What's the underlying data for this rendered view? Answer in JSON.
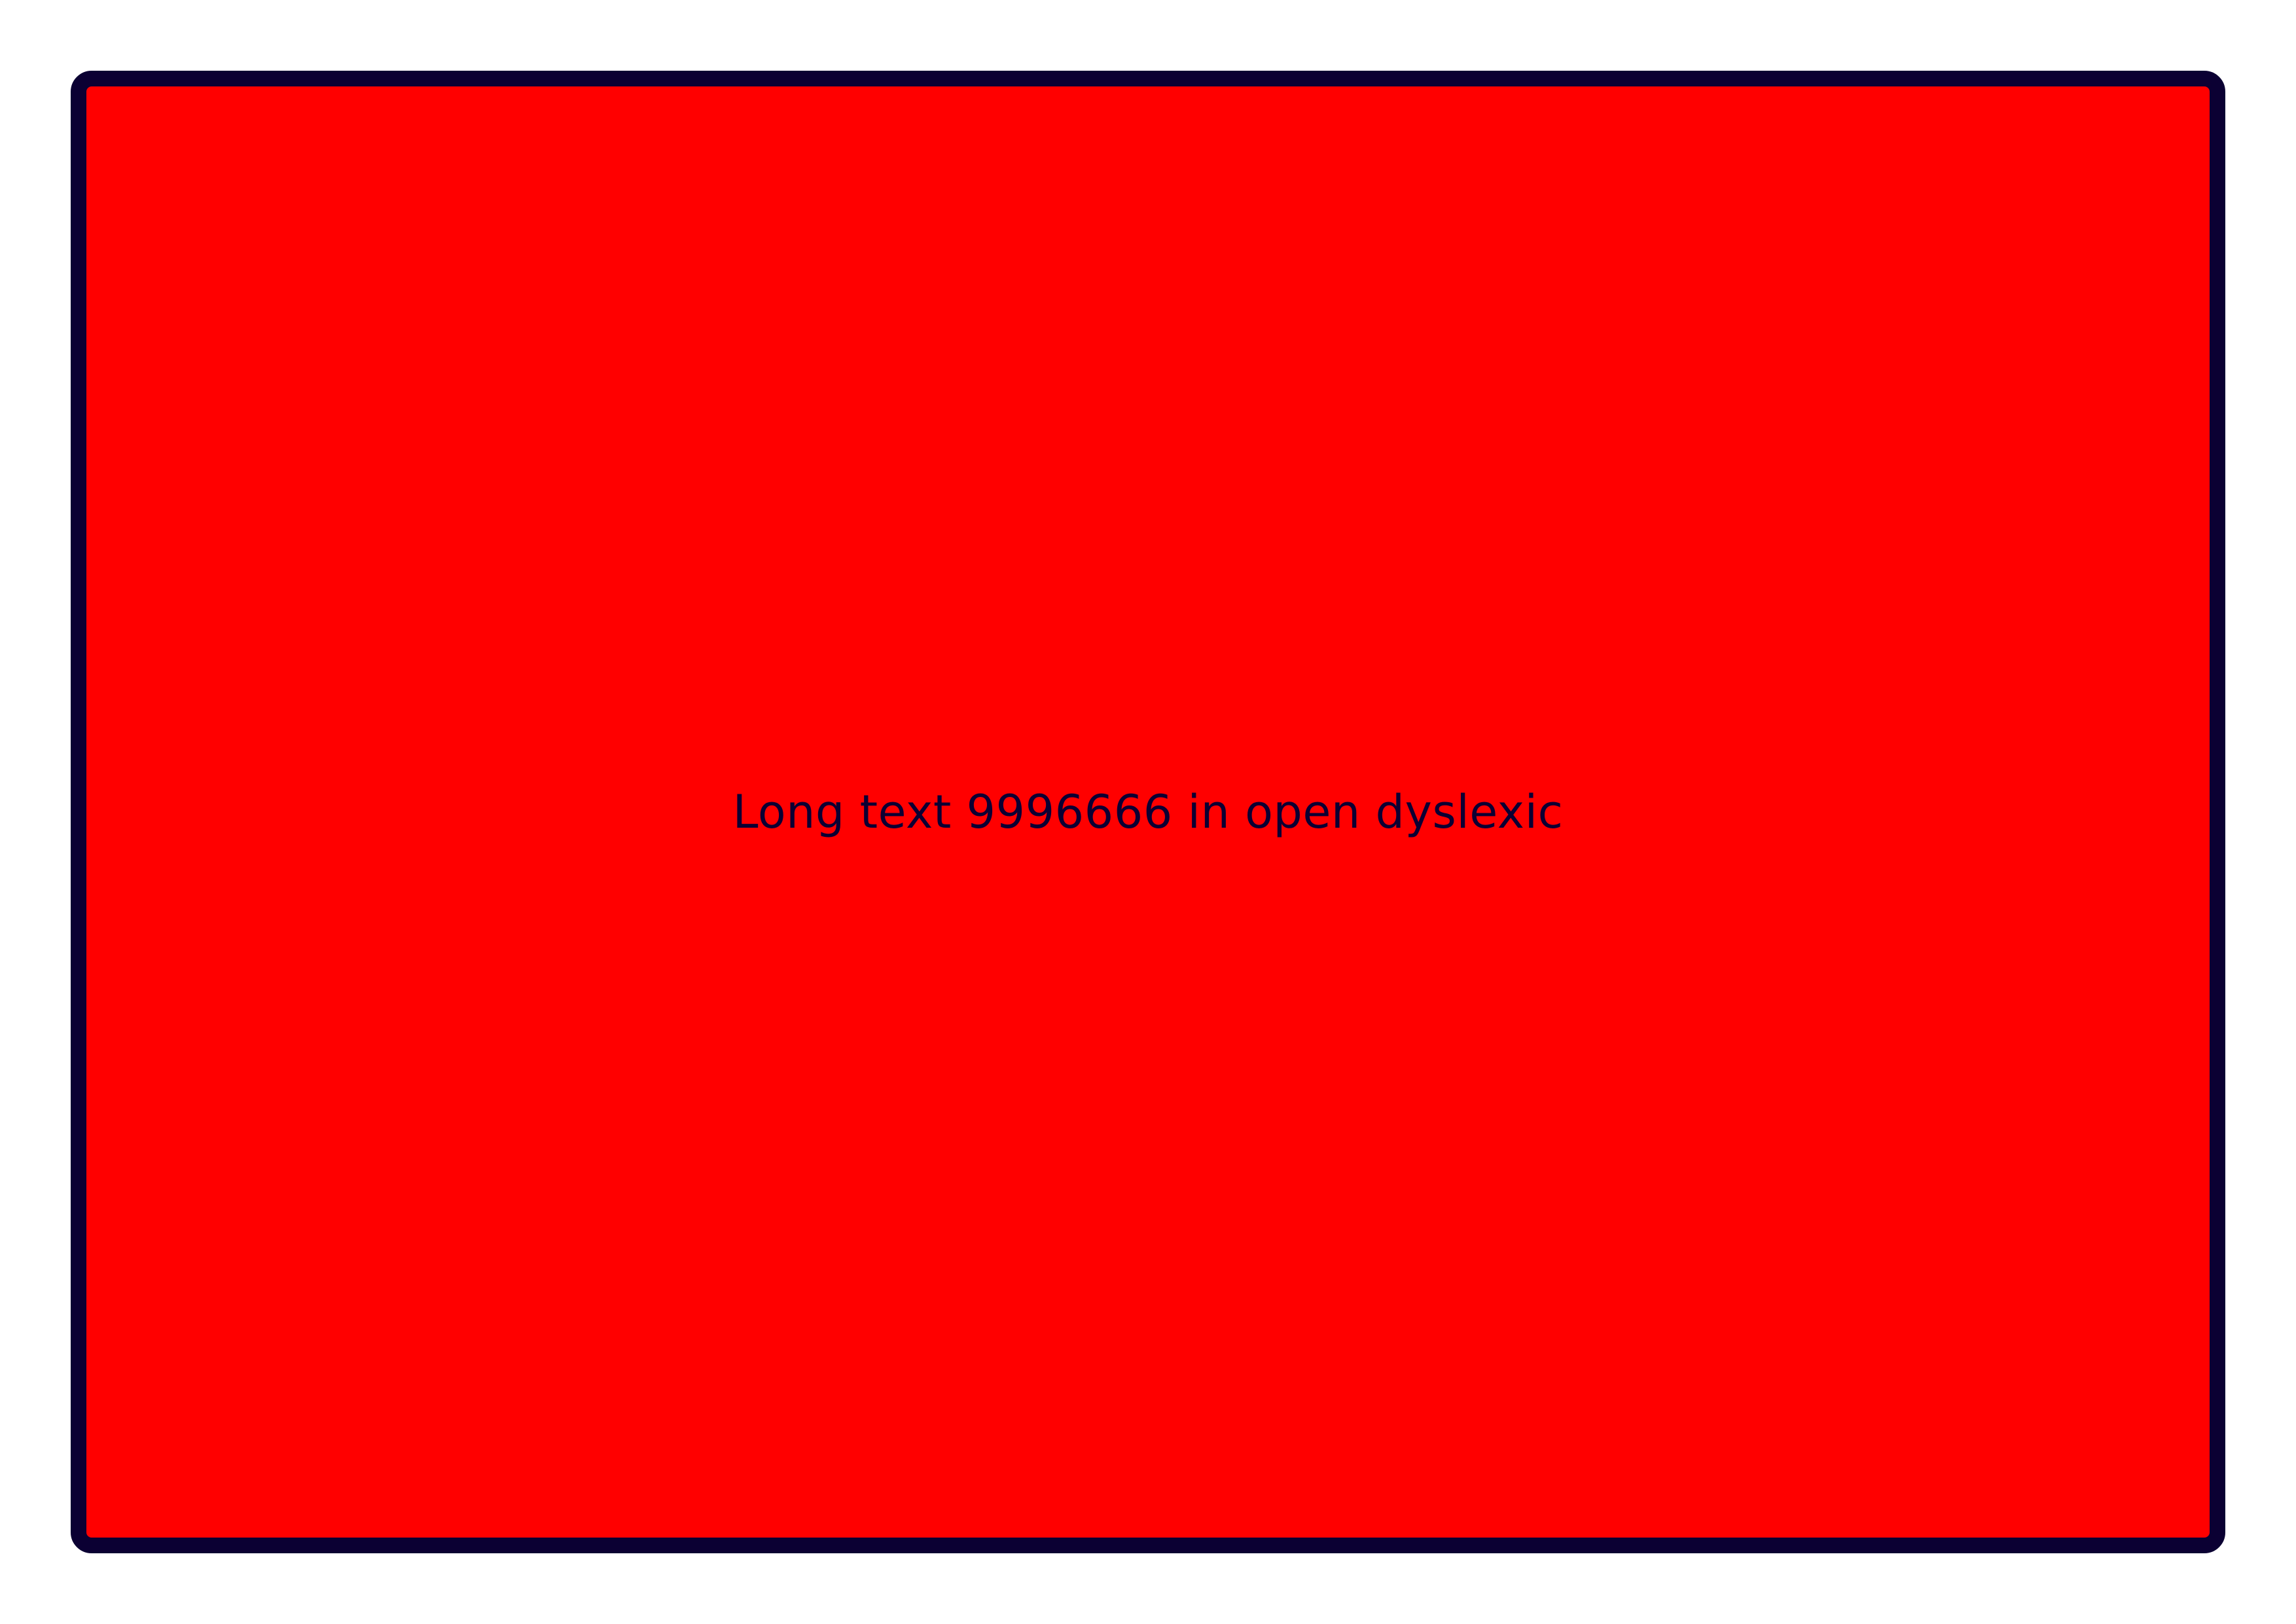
{
  "panel": {
    "text": "Long text 9996666 in open dyslexic",
    "background_color": "#ff0000",
    "border_color": "#0b0033"
  },
  "page": {
    "background_color": "#ffffff"
  }
}
